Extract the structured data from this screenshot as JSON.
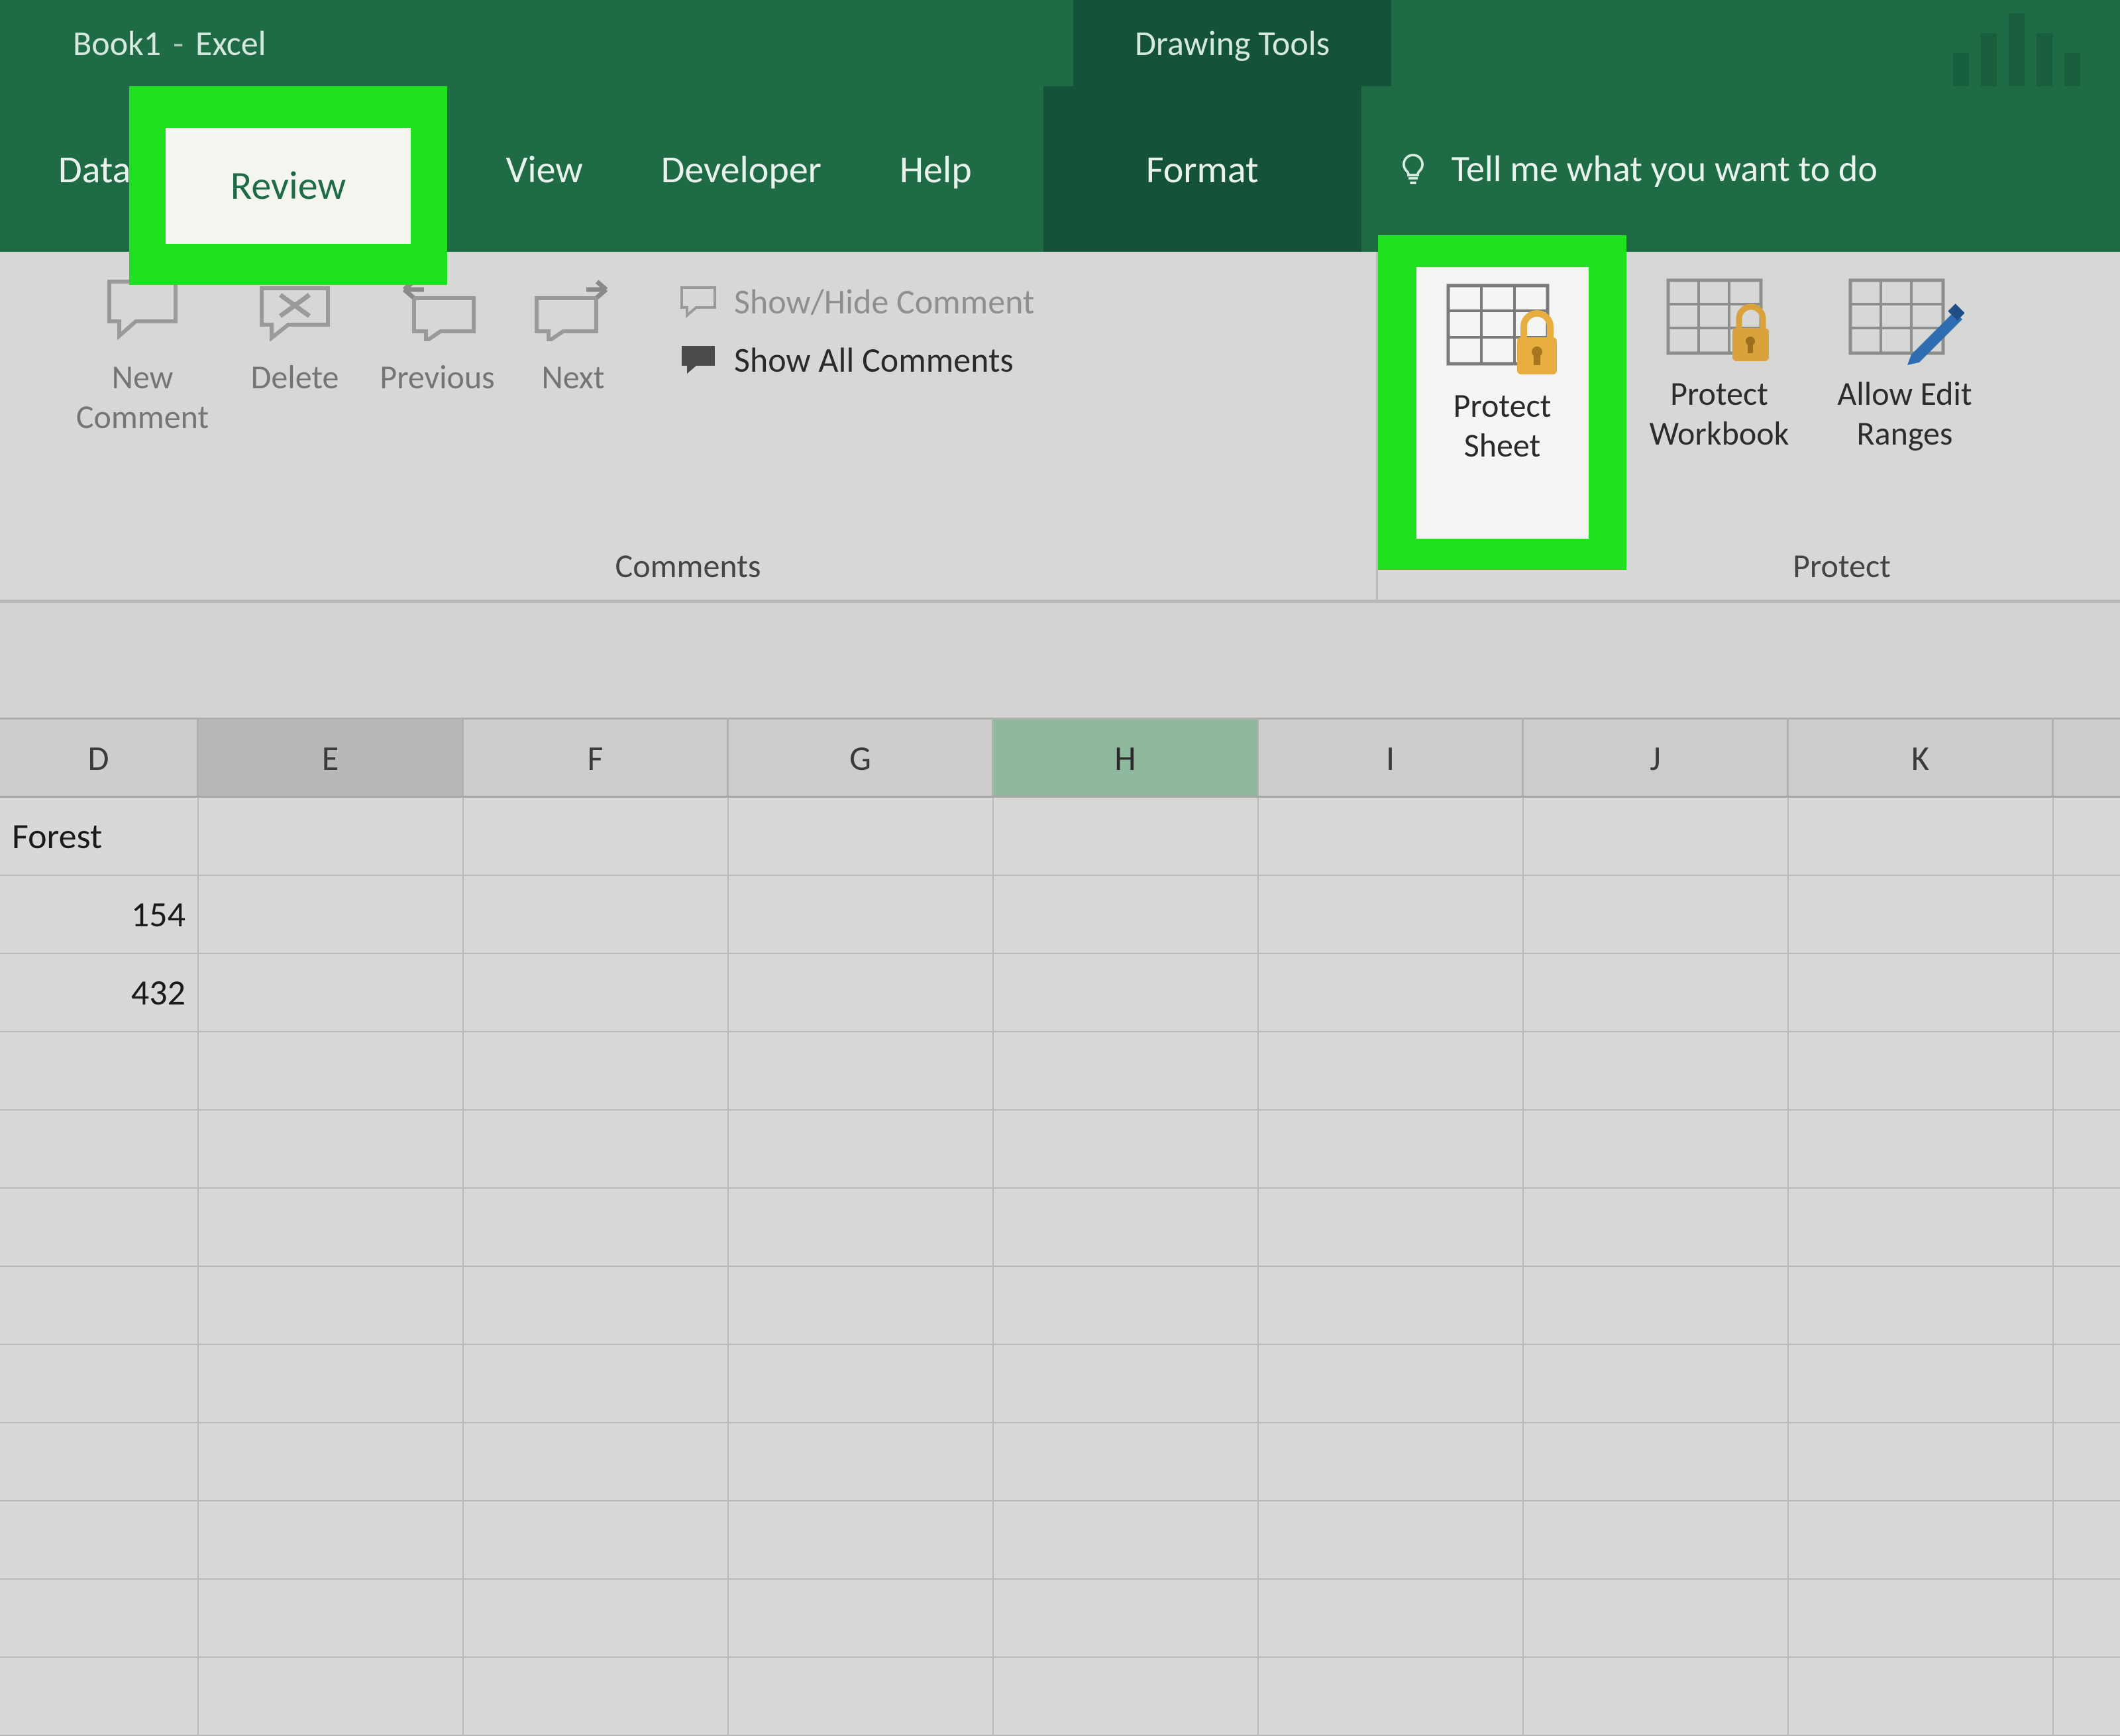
{
  "title": {
    "doc": "Book1",
    "app": "Excel"
  },
  "context_tab": "Drawing Tools",
  "tabs": {
    "data": "Data",
    "review": "Review",
    "view": "View",
    "developer": "Developer",
    "help": "Help",
    "format": "Format"
  },
  "tellme": "Tell me what you want to do",
  "ribbon": {
    "comments": {
      "new1": "New",
      "new2": "Comment",
      "delete": "Delete",
      "previous": "Previous",
      "next": "Next",
      "show_hide": "Show/Hide Comment",
      "show_all": "Show All Comments",
      "group": "Comments"
    },
    "protect": {
      "sheet1": "Protect",
      "sheet2": "Sheet",
      "wb1": "Protect",
      "wb2": "Workbook",
      "allow1": "Allow Edit",
      "allow2": "Ranges",
      "group": "Protect"
    }
  },
  "columns": [
    "D",
    "E",
    "F",
    "G",
    "H",
    "I",
    "J",
    "K"
  ],
  "rows": [
    {
      "d": "Forest",
      "align": "left"
    },
    {
      "d": "154",
      "align": "right"
    },
    {
      "d": "432",
      "align": "right"
    },
    {
      "d": "",
      "align": "left"
    },
    {
      "d": "",
      "align": "left"
    },
    {
      "d": "",
      "align": "left"
    },
    {
      "d": "",
      "align": "left"
    },
    {
      "d": "",
      "align": "left"
    },
    {
      "d": "",
      "align": "left"
    },
    {
      "d": "",
      "align": "left"
    },
    {
      "d": "",
      "align": "left"
    },
    {
      "d": "",
      "align": "left"
    }
  ]
}
